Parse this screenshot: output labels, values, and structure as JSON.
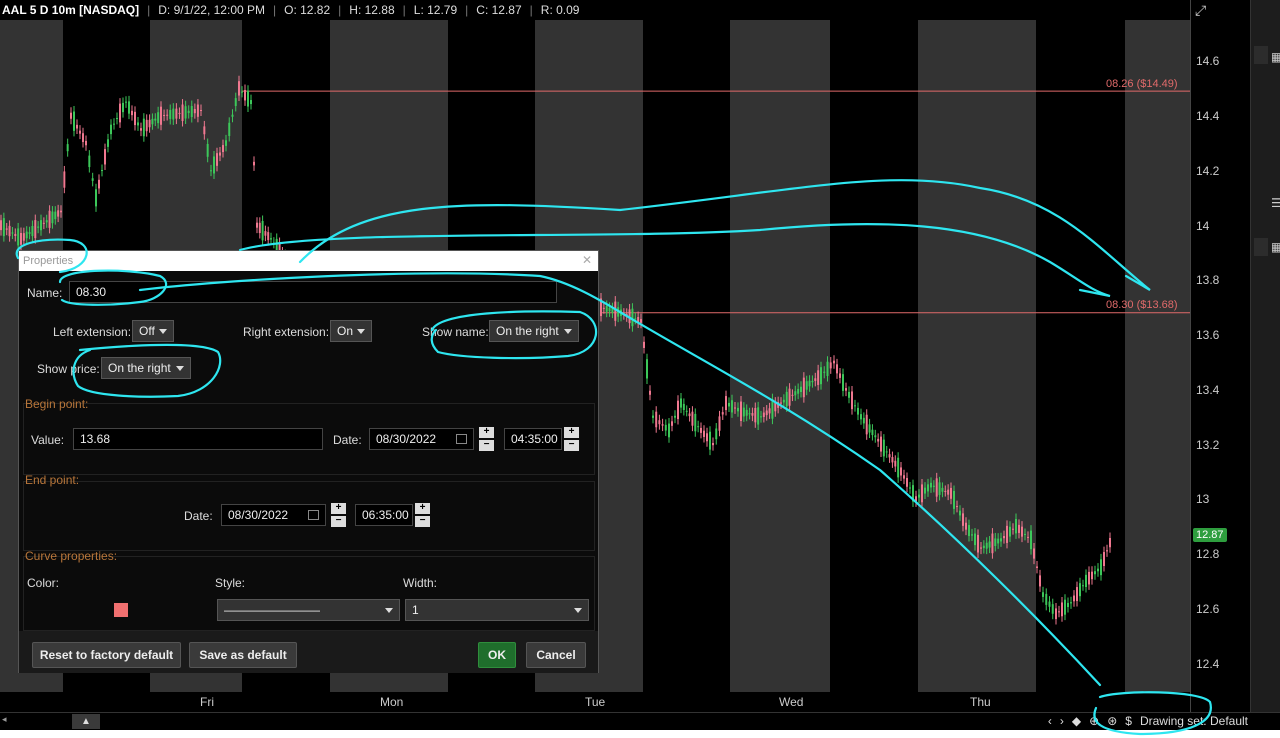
{
  "topbar": {
    "symbol": "AAL 5 D 10m [NASDAQ]",
    "date": "D: 9/1/22, 12:00 PM",
    "open": "O: 12.82",
    "high": "H: 12.88",
    "low": "L: 12.79",
    "close": "C: 12.87",
    "range": "R: 0.09"
  },
  "axis": {
    "ticks": [
      "14.6",
      "14.4",
      "14.2",
      "14",
      "13.8",
      "13.6",
      "13.4",
      "13.2",
      "13",
      "12.8",
      "12.6",
      "12.4"
    ],
    "last_price": "12.87"
  },
  "price_lines": [
    {
      "label": "08.26 ($14.49)",
      "price": 14.49
    },
    {
      "label": "08.30 ($13.68)",
      "price": 13.68
    }
  ],
  "xaxis": {
    "labels": [
      "Fri",
      "Mon",
      "Tue",
      "Wed",
      "Thu"
    ]
  },
  "status": {
    "drawing_set": "Drawing set: Default",
    "dollar": "$"
  },
  "dialog": {
    "title": "Properties",
    "name_label": "Name:",
    "name_value": "08.30",
    "left_extension_label": "Left extension:",
    "left_extension_value": "Off",
    "right_extension_label": "Right extension:",
    "right_extension_value": "On",
    "show_name_label": "Show name:",
    "show_name_value": "On the right",
    "show_price_label": "Show price:",
    "show_price_value": "On the right",
    "begin_point": {
      "title": "Begin point:",
      "value_label": "Value:",
      "value": "13.68",
      "date_label": "Date:",
      "date": "08/30/2022",
      "time": "04:35:00"
    },
    "end_point": {
      "title": "End point:",
      "date_label": "Date:",
      "date": "08/30/2022",
      "time": "06:35:00"
    },
    "curve": {
      "title": "Curve properties:",
      "color_label": "Color:",
      "color": "#f07070",
      "style_label": "Style:",
      "style_value": "————————",
      "width_label": "Width:",
      "width_value": "1"
    },
    "buttons": {
      "reset": "Reset to factory default",
      "save": "Save as default",
      "ok": "OK",
      "cancel": "Cancel"
    }
  },
  "colors": {
    "band": "#333333",
    "up_candle": "#3cc85a",
    "down_candle": "#f07890",
    "price_line": "#e06a6a",
    "annotation": "#2ee6f0"
  }
}
